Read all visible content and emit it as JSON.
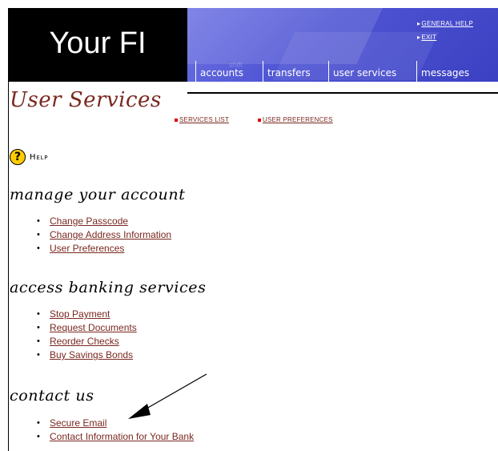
{
  "header": {
    "logo_text": "Your FI",
    "banner_watermark": "shift",
    "utility_links": [
      {
        "label": "GENERAL HELP"
      },
      {
        "label": "EXIT"
      }
    ],
    "tabs": [
      {
        "label": "accounts"
      },
      {
        "label": "transfers"
      },
      {
        "label": "user services"
      },
      {
        "label": "messages"
      }
    ],
    "banner_color": "#4f55d4"
  },
  "page": {
    "title": "User Services",
    "subnav": [
      {
        "label": "SERVICES LIST"
      },
      {
        "label": "USER PREFERENCES"
      }
    ],
    "help_label": "Help",
    "link_color": "#7a2820",
    "title_color": "#7a2820"
  },
  "sections": [
    {
      "heading": "manage your account",
      "links": [
        "Change Passcode",
        "Change Address Information",
        "User Preferences"
      ]
    },
    {
      "heading": "access banking services",
      "links": [
        "Stop Payment",
        "Request Documents",
        "Reorder Checks",
        "Buy Savings Bonds"
      ]
    },
    {
      "heading": "contact us",
      "links": [
        "Secure Email",
        "Contact Information for Your Bank"
      ]
    }
  ]
}
